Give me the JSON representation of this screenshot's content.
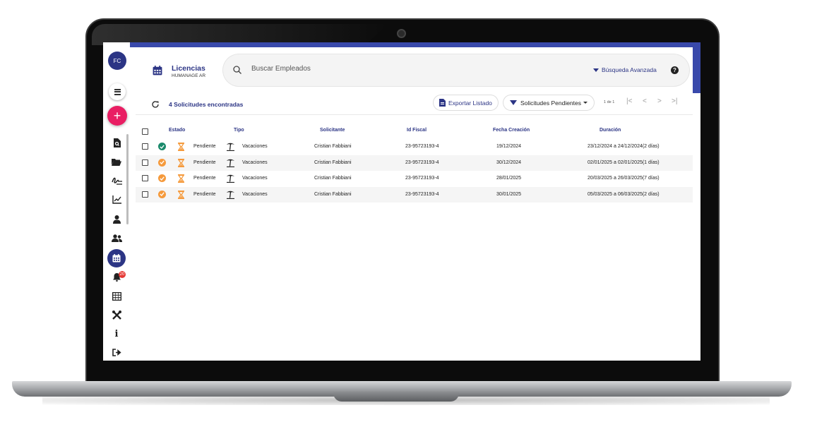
{
  "sidebar": {
    "avatar_initials": "FC",
    "notification_count": "20",
    "items": [
      {
        "icon": "search-document-icon"
      },
      {
        "icon": "folder-icon"
      },
      {
        "icon": "signature-icon"
      },
      {
        "icon": "chart-line-icon"
      },
      {
        "icon": "user-icon"
      },
      {
        "icon": "users-icon"
      },
      {
        "icon": "calendar-icon",
        "active": true
      },
      {
        "icon": "bell-icon"
      },
      {
        "icon": "table-icon"
      },
      {
        "icon": "tools-icon"
      },
      {
        "icon": "info-icon"
      },
      {
        "icon": "logout-icon"
      }
    ]
  },
  "header": {
    "title": "Licencias",
    "subtitle": "HUMANAGE AR"
  },
  "search": {
    "placeholder": "Buscar Empleados",
    "advanced_label": "Búsqueda Avanzada",
    "help_label": "?"
  },
  "toolbar": {
    "count_label": "4 Solicitudes encontradas",
    "export_label": "Exportar Listado",
    "filter_label": "Solicitudes Pendientes",
    "pager_label": "1 de 1"
  },
  "table": {
    "columns": [
      "Estado",
      "Tipo",
      "Solicitante",
      "Id Fiscal",
      "Fecha Creación",
      "Duración"
    ],
    "rows": [
      {
        "status_color": "#1b8a6b",
        "estado": "Pendiente",
        "tipo": "Vacaciones",
        "solicitante": "Cristian Fabbiani",
        "id_fiscal": "23-95723193-4",
        "fecha": "19/12/2024",
        "duracion": "23/12/2024 a 24/12/2024(2 días)"
      },
      {
        "status_color": "#f59a3c",
        "estado": "Pendiente",
        "tipo": "Vacaciones",
        "solicitante": "Cristian Fabbiani",
        "id_fiscal": "23-95723193-4",
        "fecha": "30/12/2024",
        "duracion": "02/01/2025 a 02/01/2025(1 días)"
      },
      {
        "status_color": "#f59a3c",
        "estado": "Pendiente",
        "tipo": "Vacaciones",
        "solicitante": "Cristian Fabbiani",
        "id_fiscal": "23-95723193-4",
        "fecha": "28/01/2025",
        "duracion": "20/03/2025 a 26/03/2025(7 días)"
      },
      {
        "status_color": "#f59a3c",
        "estado": "Pendiente",
        "tipo": "Vacaciones",
        "solicitante": "Cristian Fabbiani",
        "id_fiscal": "23-95723193-4",
        "fecha": "30/01/2025",
        "duracion": "05/03/2025 a 06/03/2025(2 días)"
      }
    ]
  },
  "colors": {
    "brand": "#2c3585",
    "accent_bar": "#3949ab",
    "add_button": "#e91e63",
    "pending": "#f59a3c",
    "approved": "#1b8a6b"
  }
}
